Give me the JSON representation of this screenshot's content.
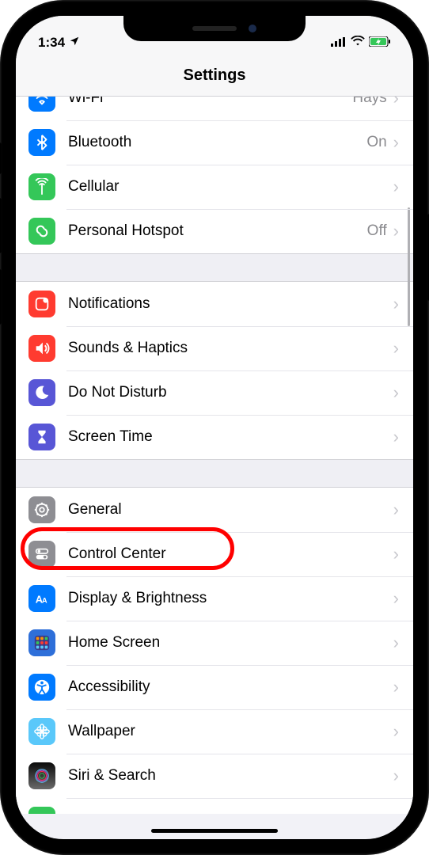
{
  "status": {
    "time": "1:34",
    "location_icon": "location-arrow-icon",
    "signal_icon": "cellular-signal-icon",
    "wifi_icon": "wifi-icon",
    "battery_icon": "battery-charging-icon"
  },
  "header": {
    "title": "Settings"
  },
  "groups": [
    {
      "rows": [
        {
          "id": "wifi",
          "icon": "wifi-icon",
          "color": "c-blue",
          "label": "Wi-Fi",
          "value": "Hays"
        },
        {
          "id": "bt",
          "icon": "bluetooth-icon",
          "color": "c-blue",
          "label": "Bluetooth",
          "value": "On"
        },
        {
          "id": "cell",
          "icon": "antenna-icon",
          "color": "c-green",
          "label": "Cellular",
          "value": ""
        },
        {
          "id": "hotspot",
          "icon": "link-icon",
          "color": "c-green",
          "label": "Personal Hotspot",
          "value": "Off"
        }
      ]
    },
    {
      "rows": [
        {
          "id": "notif",
          "icon": "notifications-icon",
          "color": "c-red",
          "label": "Notifications",
          "value": ""
        },
        {
          "id": "sound",
          "icon": "speaker-icon",
          "color": "c-red",
          "label": "Sounds & Haptics",
          "value": ""
        },
        {
          "id": "dnd",
          "icon": "moon-icon",
          "color": "c-purple",
          "label": "Do Not Disturb",
          "value": ""
        },
        {
          "id": "stime",
          "icon": "hourglass-icon",
          "color": "c-purple",
          "label": "Screen Time",
          "value": ""
        }
      ]
    },
    {
      "rows": [
        {
          "id": "general",
          "icon": "gear-icon",
          "color": "c-gray",
          "label": "General",
          "value": ""
        },
        {
          "id": "cc",
          "icon": "toggles-icon",
          "color": "c-gray",
          "label": "Control Center",
          "value": "",
          "highlight": true
        },
        {
          "id": "display",
          "icon": "text-size-icon",
          "color": "c-blue",
          "label": "Display & Brightness",
          "value": ""
        },
        {
          "id": "home",
          "icon": "grid-icon",
          "color": "c-blued",
          "label": "Home Screen",
          "value": ""
        },
        {
          "id": "access",
          "icon": "accessibility-icon",
          "color": "c-blue",
          "label": "Accessibility",
          "value": ""
        },
        {
          "id": "wall",
          "icon": "flower-icon",
          "color": "c-lblue",
          "label": "Wallpaper",
          "value": ""
        },
        {
          "id": "siri",
          "icon": "siri-icon",
          "color": "c-grad",
          "label": "Siri & Search",
          "value": ""
        }
      ]
    }
  ],
  "annotation": {
    "target": "cc"
  }
}
